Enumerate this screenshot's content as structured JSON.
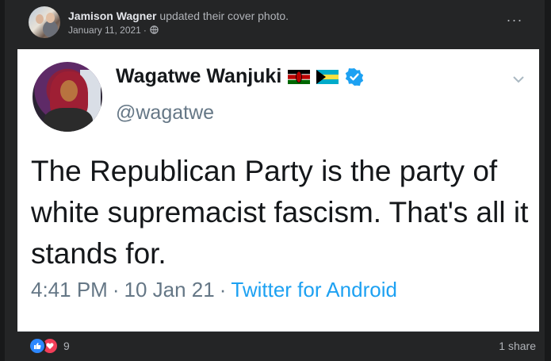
{
  "post": {
    "author": "Jamison Wagner",
    "action": "updated their cover photo.",
    "date": "January 11, 2021",
    "date_sep": "·",
    "more_label": "···",
    "privacy_icon": "globe-icon"
  },
  "tweet": {
    "display_name": "Wagatwe Wanjuki",
    "handle": "@wagatwe",
    "text": "The Republican Party is the party of white supremacist fascism. That's all it stands for.",
    "time": "4:41 PM",
    "date": "10 Jan 21",
    "source": "Twitter for Android",
    "sep": "·",
    "flags": [
      "kenya-flag-icon",
      "bahamas-flag-icon"
    ],
    "verified_color": "#1da1f2"
  },
  "footer": {
    "reaction_count": "9",
    "shares": "1 share",
    "reactions": [
      "like-icon",
      "love-icon"
    ]
  },
  "colors": {
    "background": "#242526",
    "text_primary": "#e4e6eb",
    "text_secondary": "#b0b3b8",
    "twitter_blue": "#1da1f2",
    "like_blue": "#2d88ff",
    "love_red": "#f33e58"
  }
}
